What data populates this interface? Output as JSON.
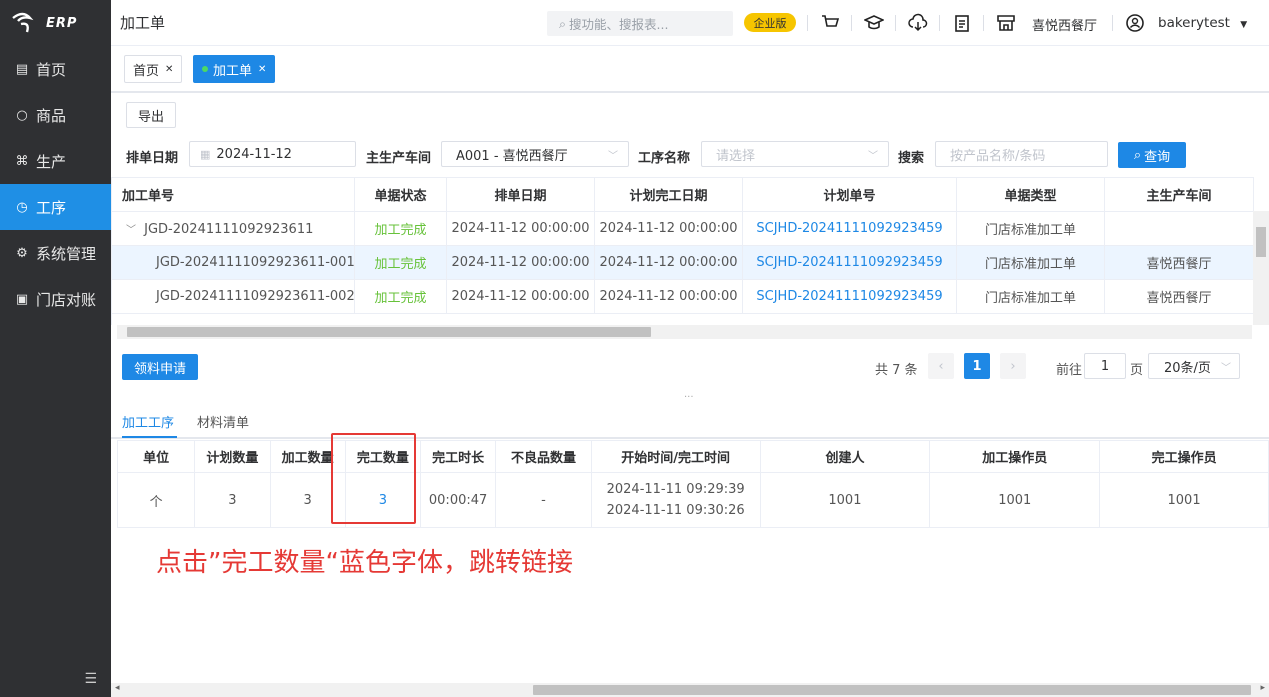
{
  "logo": {
    "text": "ERP"
  },
  "sidebar": {
    "items": [
      {
        "label": "首页",
        "icon": "dashboard-icon"
      },
      {
        "label": "商品",
        "icon": "circle-icon"
      },
      {
        "label": "生产",
        "icon": "command-icon"
      },
      {
        "label": "工序",
        "icon": "process-icon",
        "active": true
      },
      {
        "label": "系统管理",
        "icon": "gear-icon"
      },
      {
        "label": "门店对账",
        "icon": "ledger-icon"
      }
    ]
  },
  "header": {
    "title": "加工单",
    "search_placeholder": "搜功能、搜报表...",
    "edition_badge": "企业版",
    "store_name": "喜悦西餐厅",
    "user_name": "bakerytest"
  },
  "tabs": [
    {
      "label": "首页",
      "active": false
    },
    {
      "label": "加工单",
      "active": true
    }
  ],
  "toolbar": {
    "export_label": "导出"
  },
  "filters": {
    "schedule_date_label": "排单日期",
    "schedule_date_value": "2024-11-12",
    "workshop_label": "主生产车间",
    "workshop_value": "A001 - 喜悦西餐厅",
    "process_name_label": "工序名称",
    "process_name_placeholder": "请选择",
    "search_label": "搜索",
    "search_placeholder": "按产品名称/条码",
    "query_label": "查询"
  },
  "main_table": {
    "headers": [
      "加工单号",
      "单据状态",
      "排单日期",
      "计划完工日期",
      "计划单号",
      "单据类型",
      "主生产车间"
    ],
    "rows": [
      {
        "no": "JGD-20241111092923611",
        "status": "加工完成",
        "date": "2024-11-12 00:00:00",
        "plan_done": "2024-11-12 00:00:00",
        "plan_no": "SCJHD-20241111092923459",
        "type": "门店标准加工单",
        "workshop": ""
      },
      {
        "no": "JGD-20241111092923611-001",
        "status": "加工完成",
        "date": "2024-11-12 00:00:00",
        "plan_done": "2024-11-12 00:00:00",
        "plan_no": "SCJHD-20241111092923459",
        "type": "门店标准加工单",
        "workshop": "喜悦西餐厅"
      },
      {
        "no": "JGD-20241111092923611-002",
        "status": "加工完成",
        "date": "2024-11-12 00:00:00",
        "plan_done": "2024-11-12 00:00:00",
        "plan_no": "SCJHD-20241111092923459",
        "type": "门店标准加工单",
        "workshop": "喜悦西餐厅"
      }
    ]
  },
  "material_button": "领料申请",
  "pagination": {
    "total": "共 7 条",
    "current_page": "1",
    "goto_label": "前往",
    "goto_value": "1",
    "page_unit": "页",
    "page_size": "20条/页"
  },
  "bottom_tabs": [
    {
      "label": "加工工序",
      "active": true
    },
    {
      "label": "材料清单",
      "active": false
    }
  ],
  "detail_table": {
    "headers": [
      "单位",
      "计划数量",
      "加工数量",
      "完工数量",
      "完工时长",
      "不良品数量",
      "开始时间/完工时间",
      "创建人",
      "加工操作员",
      "完工操作员"
    ],
    "row": {
      "unit": "个",
      "planned": "3",
      "processed": "3",
      "completed": "3",
      "duration": "00:00:47",
      "defects": "-",
      "start_time": "2024-11-11 09:29:39",
      "end_time": "2024-11-11 09:30:26",
      "creator": "1001",
      "operator": "1001",
      "finisher": "1001"
    }
  },
  "annotation": "点击”完工数量“蓝色字体，跳转链接"
}
